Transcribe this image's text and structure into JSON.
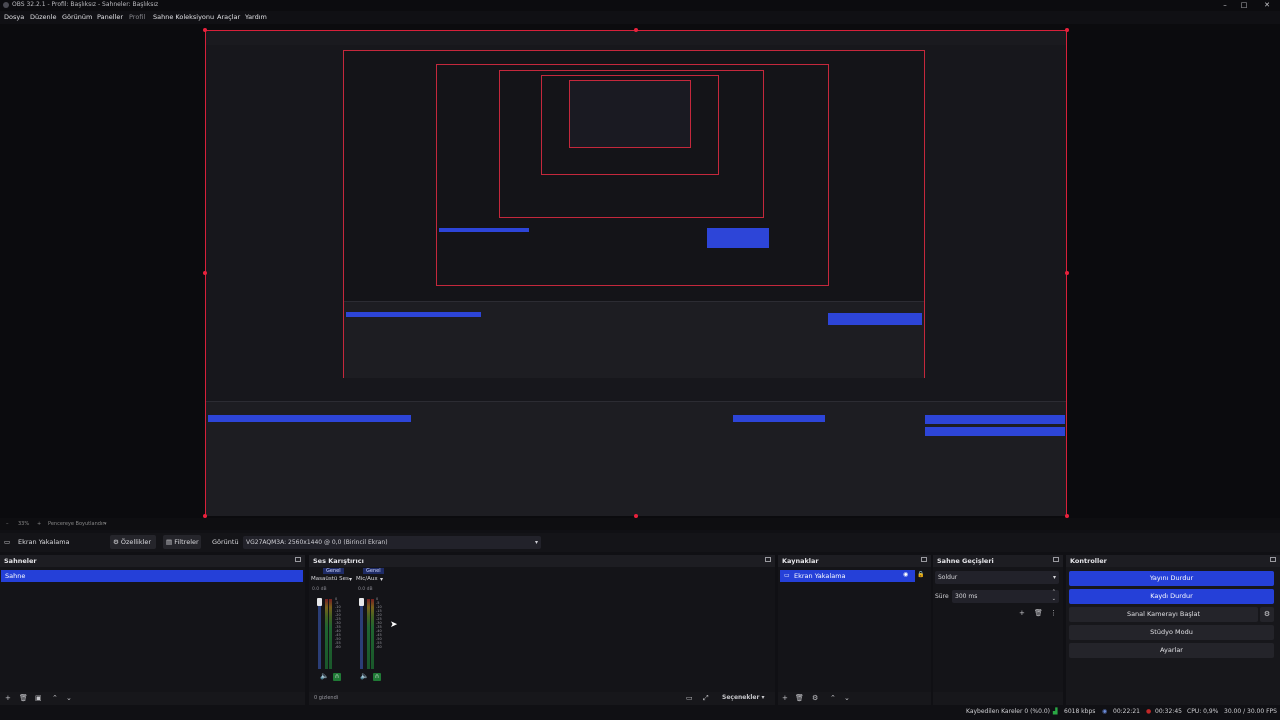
{
  "window": {
    "title": "OBS 32.2.1 - Profil: Başlıksız - Sahneler: Başlıksız"
  },
  "menu": [
    "Dosya",
    "Düzenle",
    "Görünüm",
    "Paneller",
    "Profil",
    "Sahne Koleksiyonu",
    "Araçlar",
    "Yardım"
  ],
  "zoom_bar": {
    "zoom": "33%",
    "fit_label": "Pencereye Boyutlandır"
  },
  "source_toolbar": {
    "source_name": "Ekran Yakalama",
    "properties_label": "Özellikler",
    "filters_label": "Filtreler",
    "display_label": "Görüntü",
    "display_value": "VG27AQM3A: 2560x1440 @ 0,0 (Birincil Ekran)"
  },
  "scenes": {
    "title": "Sahneler",
    "items": [
      "Sahne"
    ],
    "selected": "Sahne"
  },
  "mixer": {
    "title": "Ses Karıştırıcı",
    "channels": [
      {
        "label": "Genel",
        "name": "Masaüstü Ses",
        "db": "0.0 dB"
      },
      {
        "label": "Genel",
        "name": "Mic/Aux",
        "db": "0.0 dB"
      }
    ],
    "ticks": [
      "0",
      "-5",
      "-10",
      "-15",
      "-20",
      "-25",
      "-30",
      "-35",
      "-40",
      "-45",
      "-50",
      "-55",
      "-60"
    ],
    "hidden_label": "0 gizlendi",
    "options_label": "Seçenekler"
  },
  "sources": {
    "title": "Kaynaklar",
    "items": [
      "Ekran Yakalama"
    ]
  },
  "transitions": {
    "title": "Sahne Geçişleri",
    "type": "Soldur",
    "duration_label": "Süre",
    "duration": "300 ms"
  },
  "controls": {
    "title": "Kontroller",
    "buttons": [
      "Yayını Durdur",
      "Kaydı Durdur",
      "Sanal Kamerayı Başlat",
      "Stüdyo Modu",
      "Ayarlar"
    ],
    "active": [
      true,
      true,
      false,
      false,
      false
    ]
  },
  "status": {
    "dropped_frames": "Kaybedilen Kareler 0 (%0.0)",
    "bitrate": "6018 kbps",
    "stream_time": "00:22:21",
    "rec_time": "00:32:45",
    "cpu": "CPU: 0,9%",
    "fps": "30.00 / 30.00 FPS"
  },
  "colors": {
    "accent": "#2540d8",
    "selection_red": "#d7203a",
    "live_green": "#2aa844",
    "rec_red": "#c22828"
  }
}
